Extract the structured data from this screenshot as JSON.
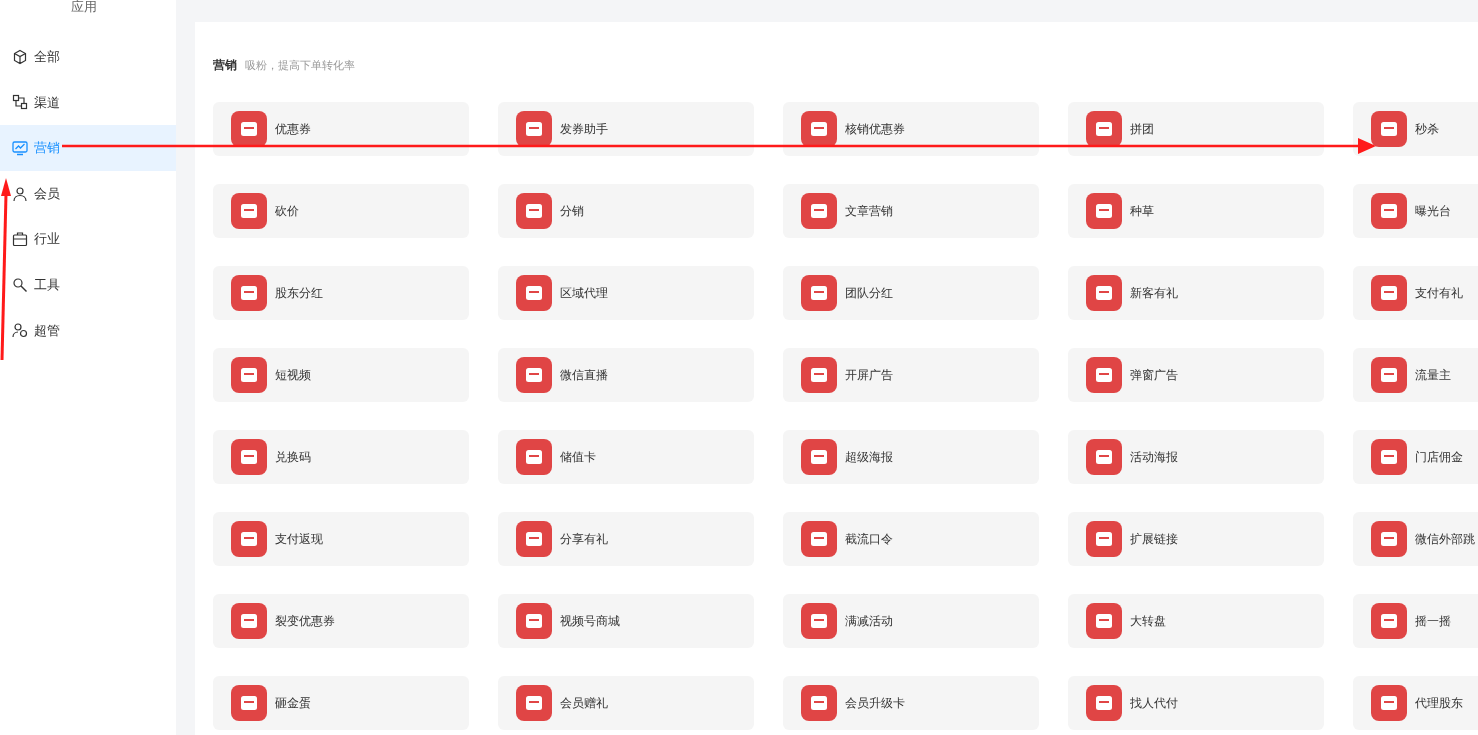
{
  "sidebar": {
    "title": "应用",
    "items": [
      {
        "label": "全部",
        "selected": false
      },
      {
        "label": "渠道",
        "selected": false
      },
      {
        "label": "营销",
        "selected": true
      },
      {
        "label": "会员",
        "selected": false
      },
      {
        "label": "行业",
        "selected": false
      },
      {
        "label": "工具",
        "selected": false
      },
      {
        "label": "超管",
        "selected": false
      }
    ]
  },
  "section": {
    "title": "营销",
    "subtitle": "吸粉，提高下单转化率"
  },
  "apps": [
    {
      "label": "优惠券"
    },
    {
      "label": "发券助手"
    },
    {
      "label": "核销优惠券"
    },
    {
      "label": "拼团"
    },
    {
      "label": "秒杀"
    },
    {
      "label": "砍价"
    },
    {
      "label": "分销"
    },
    {
      "label": "文章营销"
    },
    {
      "label": "种草"
    },
    {
      "label": "曝光台"
    },
    {
      "label": "股东分红"
    },
    {
      "label": "区域代理"
    },
    {
      "label": "团队分红"
    },
    {
      "label": "新客有礼"
    },
    {
      "label": "支付有礼"
    },
    {
      "label": "短视频"
    },
    {
      "label": "微信直播"
    },
    {
      "label": "开屏广告"
    },
    {
      "label": "弹窗广告"
    },
    {
      "label": "流量主"
    },
    {
      "label": "兑换码"
    },
    {
      "label": "储值卡"
    },
    {
      "label": "超级海报"
    },
    {
      "label": "活动海报"
    },
    {
      "label": "门店佣金"
    },
    {
      "label": "支付返现"
    },
    {
      "label": "分享有礼"
    },
    {
      "label": "截流口令"
    },
    {
      "label": "扩展链接"
    },
    {
      "label": "微信外部跳"
    },
    {
      "label": "裂变优惠券"
    },
    {
      "label": "视频号商城"
    },
    {
      "label": "满减活动"
    },
    {
      "label": "大转盘"
    },
    {
      "label": "摇一摇"
    },
    {
      "label": "砸金蛋"
    },
    {
      "label": "会员赠礼"
    },
    {
      "label": "会员升级卡"
    },
    {
      "label": "找人代付"
    },
    {
      "label": "代理股东"
    }
  ]
}
